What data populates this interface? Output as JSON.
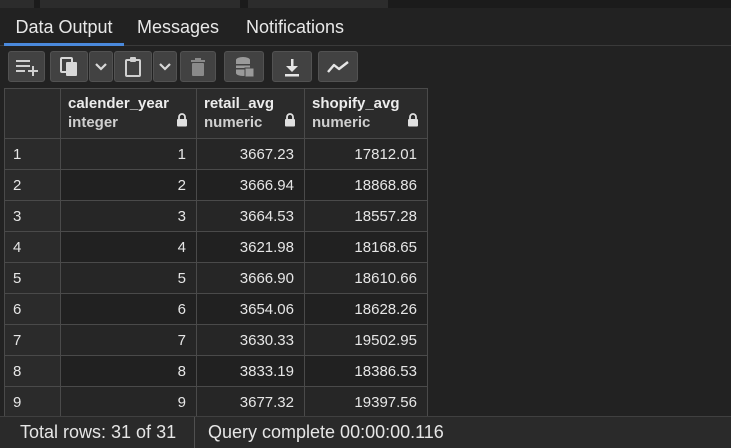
{
  "tabs": [
    {
      "label": "Data Output",
      "active": true
    },
    {
      "label": "Messages",
      "active": false
    },
    {
      "label": "Notifications",
      "active": false
    }
  ],
  "toolbar": {
    "buttons": [
      {
        "name": "add-row-button",
        "icon": "add-row-icon"
      },
      {
        "name": "copy-button",
        "icon": "copy-icon"
      },
      {
        "name": "copy-options-dropdown",
        "icon": "chevron-down-icon"
      },
      {
        "name": "paste-button",
        "icon": "clipboard-icon"
      },
      {
        "name": "paste-options-dropdown",
        "icon": "chevron-down-icon"
      },
      {
        "name": "delete-button",
        "icon": "trash-icon"
      },
      {
        "name": "save-data-button",
        "icon": "database-save-icon"
      },
      {
        "name": "download-button",
        "icon": "download-icon"
      },
      {
        "name": "graph-visualiser-button",
        "icon": "line-chart-icon"
      }
    ]
  },
  "grid": {
    "columns": [
      {
        "name": "calender_year",
        "type": "integer"
      },
      {
        "name": "retail_avg",
        "type": "numeric"
      },
      {
        "name": "shopify_avg",
        "type": "numeric"
      }
    ],
    "rows": [
      {
        "row": "1",
        "calender_year": "1",
        "retail_avg": "3667.23",
        "shopify_avg": "17812.01"
      },
      {
        "row": "2",
        "calender_year": "2",
        "retail_avg": "3666.94",
        "shopify_avg": "18868.86"
      },
      {
        "row": "3",
        "calender_year": "3",
        "retail_avg": "3664.53",
        "shopify_avg": "18557.28"
      },
      {
        "row": "4",
        "calender_year": "4",
        "retail_avg": "3621.98",
        "shopify_avg": "18168.65"
      },
      {
        "row": "5",
        "calender_year": "5",
        "retail_avg": "3666.90",
        "shopify_avg": "18610.66"
      },
      {
        "row": "6",
        "calender_year": "6",
        "retail_avg": "3654.06",
        "shopify_avg": "18628.26"
      },
      {
        "row": "7",
        "calender_year": "7",
        "retail_avg": "3630.33",
        "shopify_avg": "19502.95"
      },
      {
        "row": "8",
        "calender_year": "8",
        "retail_avg": "3833.19",
        "shopify_avg": "18386.53"
      },
      {
        "row": "9",
        "calender_year": "9",
        "retail_avg": "3677.32",
        "shopify_avg": "19397.56"
      }
    ]
  },
  "status": {
    "total_rows": "Total rows: 31 of 31",
    "query_status": "Query complete 00:00:00.116"
  },
  "colors": {
    "background": "#222222",
    "active_tab_underline": "#4a89dc",
    "button_bg": "#424242",
    "grid_border": "#4a4a4a"
  }
}
